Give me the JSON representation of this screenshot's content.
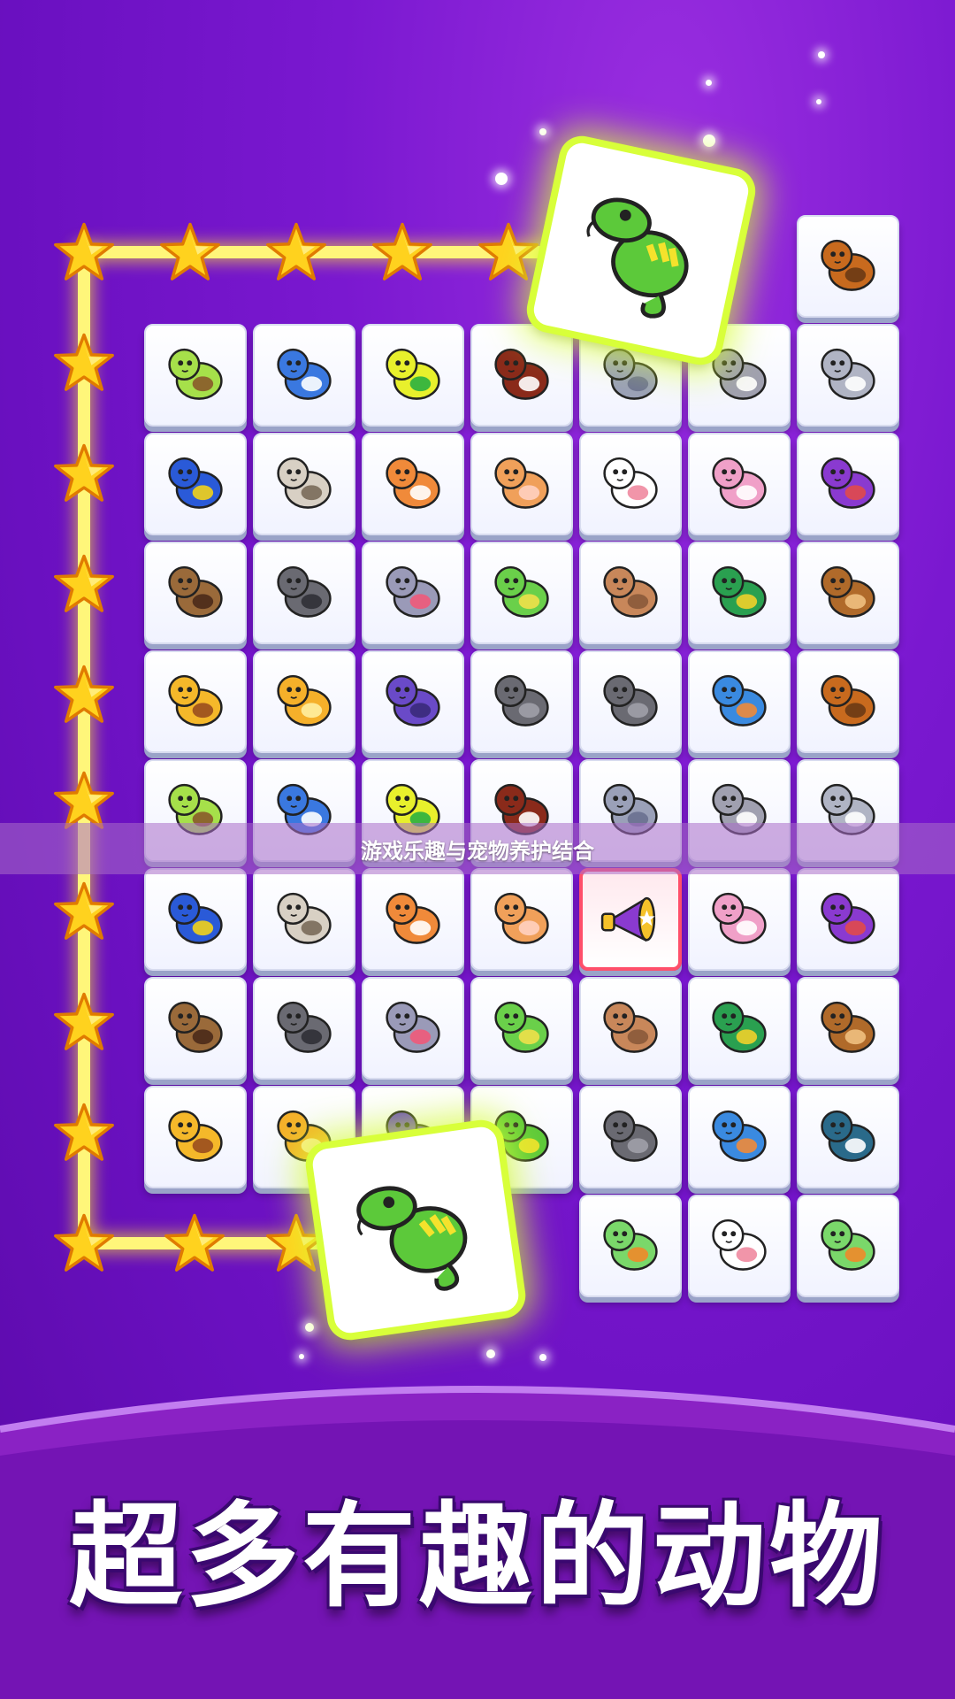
{
  "banner": {
    "text": "游戏乐趣与宠物养护结合"
  },
  "title": {
    "text": "超多有趣的动物"
  },
  "colors": {
    "path": "#ffe52e",
    "highlight": "#d8ff3a",
    "hint_border": "#ff4f6a"
  },
  "board": {
    "rows": [
      [
        "blank",
        "blank",
        "blank",
        "blank",
        "blank",
        "blank",
        "yak"
      ],
      [
        "turtle",
        "bluebird",
        "fish",
        "eagle",
        "pigeon",
        "donkey",
        "worm"
      ],
      [
        "butterfly",
        "cat",
        "fox",
        "hamster",
        "dog-white",
        "squid",
        "scorpion"
      ],
      [
        "beetle",
        "spider",
        "rabbit",
        "caterpillar",
        "puppy",
        "parrot",
        "bear"
      ],
      [
        "tortoise",
        "snake",
        "bat",
        "ant",
        "ant",
        "dino",
        "yak"
      ],
      [
        "turtle",
        "bluebird",
        "fish",
        "eagle",
        "pigeon",
        "donkey",
        "worm"
      ],
      [
        "butterfly",
        "cat",
        "fox",
        "hamster",
        "megaphone",
        "squid",
        "scorpion"
      ],
      [
        "beetle",
        "spider",
        "rabbit",
        "caterpillar",
        "puppy",
        "parrot",
        "bear"
      ],
      [
        "tortoise",
        "snake",
        "bat",
        "chameleon",
        "ant",
        "dino",
        "magpie"
      ],
      [
        "blank",
        "blank",
        "blank",
        "blank",
        "frog",
        "dog-white",
        "frog"
      ]
    ],
    "highlighted_tile": "chameleon",
    "hint_tile": "megaphone"
  }
}
